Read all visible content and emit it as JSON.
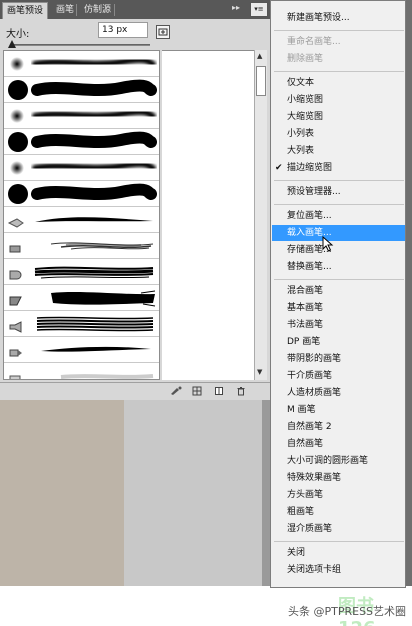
{
  "panel": {
    "tabs": [
      "画笔预设",
      "画笔",
      "仿制源"
    ],
    "panel_controls": "▸▸",
    "menu_button": "▾≡",
    "size_label": "大小:",
    "size_value": "13 px",
    "slider_level": 0.0
  },
  "brushes": [
    {
      "tip": "soft-small",
      "stroke": "soft-thin"
    },
    {
      "tip": "hard-large",
      "stroke": "hard-thick"
    },
    {
      "tip": "soft-small",
      "stroke": "soft-thin"
    },
    {
      "tip": "hard-large",
      "stroke": "hard-thick"
    },
    {
      "tip": "soft-small",
      "stroke": "soft-thin"
    },
    {
      "tip": "hard-large",
      "stroke": "hard-thick"
    },
    {
      "tip": "pen",
      "stroke": "taper"
    },
    {
      "tip": "chalk",
      "stroke": "chalk"
    },
    {
      "tip": "round-flat",
      "stroke": "bristle"
    },
    {
      "tip": "angled",
      "stroke": "heavy-bristle"
    },
    {
      "tip": "fan",
      "stroke": "fan"
    },
    {
      "tip": "pencil",
      "stroke": "taper-long"
    },
    {
      "tip": "wet",
      "stroke": "faint"
    }
  ],
  "menu": {
    "items": [
      {
        "label": "新建画笔预设...",
        "state": "normal"
      },
      {
        "sep": true
      },
      {
        "label": "重命名画笔...",
        "state": "disabled"
      },
      {
        "label": "删除画笔",
        "state": "disabled"
      },
      {
        "sep": true
      },
      {
        "label": "仅文本",
        "state": "normal"
      },
      {
        "label": "小缩览图",
        "state": "normal"
      },
      {
        "label": "大缩览图",
        "state": "normal"
      },
      {
        "label": "小列表",
        "state": "normal"
      },
      {
        "label": "大列表",
        "state": "normal"
      },
      {
        "label": "描边缩览图",
        "state": "checked"
      },
      {
        "sep": true
      },
      {
        "label": "预设管理器...",
        "state": "normal"
      },
      {
        "sep": true
      },
      {
        "label": "复位画笔...",
        "state": "normal"
      },
      {
        "label": "载入画笔...",
        "state": "highlighted"
      },
      {
        "label": "存储画笔...",
        "state": "normal"
      },
      {
        "label": "替换画笔...",
        "state": "normal"
      },
      {
        "sep": true
      },
      {
        "label": "混合画笔",
        "state": "normal"
      },
      {
        "label": "基本画笔",
        "state": "normal"
      },
      {
        "label": "书法画笔",
        "state": "normal"
      },
      {
        "label": "DP 画笔",
        "state": "normal"
      },
      {
        "label": "带阴影的画笔",
        "state": "normal"
      },
      {
        "label": "干介质画笔",
        "state": "normal"
      },
      {
        "label": "人造材质画笔",
        "state": "normal"
      },
      {
        "label": "M 画笔",
        "state": "normal"
      },
      {
        "label": "自然画笔 2",
        "state": "normal"
      },
      {
        "label": "自然画笔",
        "state": "normal"
      },
      {
        "label": "大小可调的圆形画笔",
        "state": "normal"
      },
      {
        "label": "特殊效果画笔",
        "state": "normal"
      },
      {
        "label": "方头画笔",
        "state": "normal"
      },
      {
        "label": "粗画笔",
        "state": "normal"
      },
      {
        "label": "湿介质画笔",
        "state": "normal"
      },
      {
        "sep": true
      },
      {
        "label": "关闭",
        "state": "normal"
      },
      {
        "label": "关闭选项卡组",
        "state": "normal"
      }
    ]
  },
  "watermark": {
    "text": "头条 @PTPRESS艺术圈",
    "logo": "图书126"
  },
  "colors": {
    "highlight": "#3399ff",
    "tabbar": "#585858",
    "panel_bg": "#d7d7d7",
    "menu_bg": "#f0f0f0"
  }
}
